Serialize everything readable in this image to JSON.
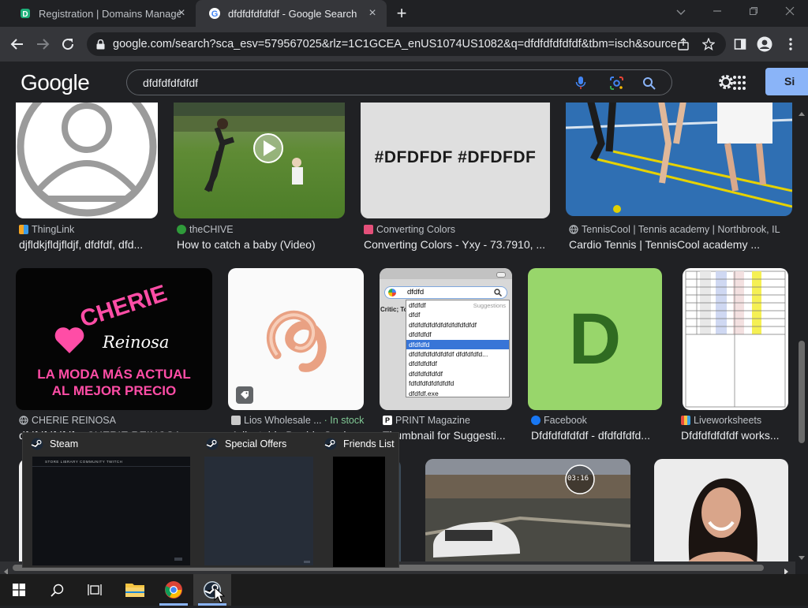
{
  "browser": {
    "tabs": [
      {
        "title": "Registration | Domains Manager",
        "active": false
      },
      {
        "title": "dfdfdfdfdfdf - Google Search",
        "active": true
      }
    ],
    "url": "google.com/search?sca_esv=579567025&rlz=1C1GCEA_enUS1074US1082&q=dfdfdfdfdfdf&tbm=isch&source=..."
  },
  "google": {
    "logo": "Google",
    "query": "dfdfdfdfdfdf",
    "signin_label": "Si"
  },
  "results": [
    {
      "source": "ThingLink",
      "title": "djfldkjfldjfldjf, dfdfdf, dfd...",
      "thumb_text": ""
    },
    {
      "source": "theCHIVE",
      "title": "How to catch a baby (Video)",
      "thumb_text": ""
    },
    {
      "source": "Converting Colors",
      "title": "Converting Colors - Yxy - 73.7910, ...",
      "thumb_text": "#DFDFDF #DFDFDF"
    },
    {
      "source": "TennisCool | Tennis academy | Northbrook, IL",
      "title": "Cardio Tennis | TennisCool academy ...",
      "thumb_text": ""
    },
    {
      "source": "CHERIE REINOSA",
      "title": "dfdfdfdfdfdf – CHERIE REINOSA",
      "thumb_lines": [
        "CHERIE",
        "Reinosa",
        "LA MODA MÁS ACTUAL",
        "AL MEJOR PRECIO"
      ]
    },
    {
      "source": "Lios Wholesale ...",
      "instock": "· In stock",
      "title": "Adjustable Double Snak..."
    },
    {
      "source": "PRINT Magazine",
      "title": "Thumbnail for Suggesti...",
      "popup_input": "dfdfd",
      "popup_header": "Suggestions",
      "popup_items": [
        "dfdfdf",
        "dfdf",
        "dfdfdfdfdfdfdfdfdfdfdfdf",
        "dfdfdfdf",
        "dfdfdfd",
        "dfdfdfdfdfdfdfdf dfdfdfdfd...",
        "dfdfdfdfdf",
        "dfdfdfdfdfdf",
        "fdfdfdfdfdfdfdfd",
        "dfdfdf.exe"
      ],
      "popup_side": "Critic; To"
    },
    {
      "source": "Facebook",
      "title": "Dfdfdfdfdfdf - dfdfdfdfd...",
      "thumb_text": "D"
    },
    {
      "source": "Liveworksheets",
      "title": "Dfdfdfdfdfdf works...",
      "thumb_text": ""
    }
  ],
  "game_overlay": {
    "speed": "03:16"
  },
  "steam_popup": {
    "windows": [
      {
        "title": "Steam",
        "menu": "STORE   LIBRARY   COMMUNITY   TWITCH"
      },
      {
        "title": "Special Offers"
      },
      {
        "title": "Friends List"
      }
    ]
  },
  "colors": {
    "bg": "#202124",
    "toolbar": "#35363a",
    "taskbar": "#1c1c1c",
    "accent_blue": "#8ab4f8",
    "instock_green": "#81c995",
    "facebook_tile": "#98d66b",
    "facebook_letter": "#2f6b21"
  }
}
